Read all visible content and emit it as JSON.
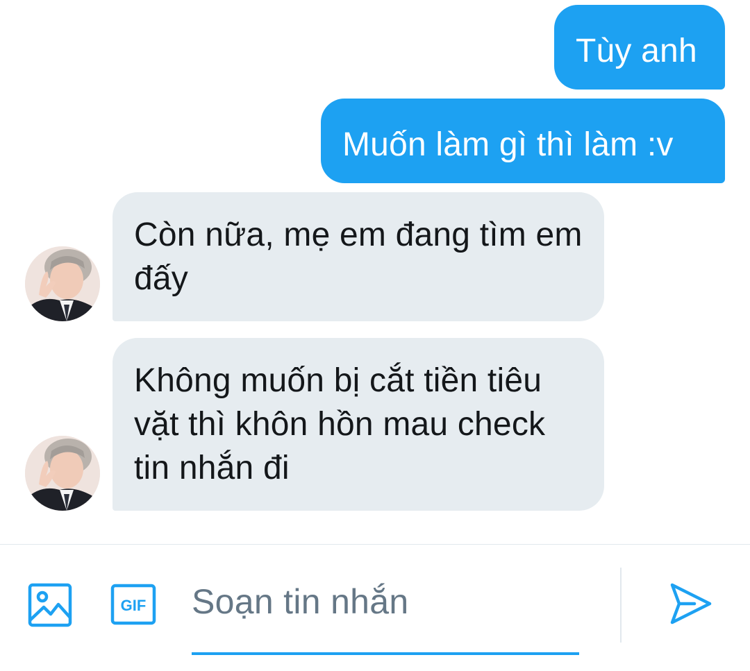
{
  "conversation": {
    "messages": [
      {
        "from": "me",
        "text": "Tùy anh"
      },
      {
        "from": "me",
        "text": "Muốn làm gì thì làm :v"
      },
      {
        "from": "contact",
        "text": "Còn nữa, mẹ em đang tìm em đấy"
      },
      {
        "from": "contact",
        "text": "Không muốn bị cắt tiền tiêu vặt thì khôn hồn mau check tin nhắn đi"
      }
    ]
  },
  "composer": {
    "placeholder": "Soạn tin nhắn",
    "media_icon": "image-icon",
    "gif_icon": "gif-icon",
    "gif_label": "GIF",
    "send_icon": "send-icon"
  },
  "colors": {
    "accent": "#1da1f2",
    "received_bubble": "#e6ecf0",
    "received_text": "#14171a",
    "placeholder_text": "#657786",
    "divider": "#e1e8ed"
  }
}
